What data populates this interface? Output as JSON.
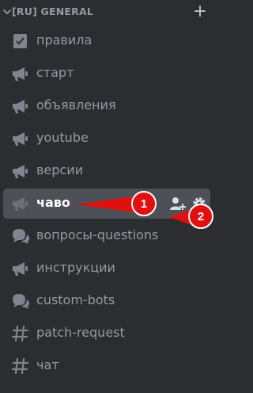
{
  "category": {
    "title": "[RU] GENERAL",
    "collapse_icon": "chevron-down-icon",
    "add_icon": "plus-icon"
  },
  "channels": [
    {
      "name": "правила",
      "icon": "rules-icon",
      "selected": false
    },
    {
      "name": "старт",
      "icon": "announcement-icon",
      "selected": false
    },
    {
      "name": "объявления",
      "icon": "announcement-icon",
      "selected": false
    },
    {
      "name": "youtube",
      "icon": "announcement-icon",
      "selected": false
    },
    {
      "name": "версии",
      "icon": "announcement-icon",
      "selected": false
    },
    {
      "name": "чаво",
      "icon": "announcement-icon",
      "selected": true
    },
    {
      "name": "вопросы-questions",
      "icon": "forum-icon",
      "selected": false
    },
    {
      "name": "инструкции",
      "icon": "announcement-icon",
      "selected": false
    },
    {
      "name": "custom-bots",
      "icon": "forum-icon",
      "selected": false
    },
    {
      "name": "patch-request",
      "icon": "hash-icon",
      "selected": false
    },
    {
      "name": "чат",
      "icon": "hash-icon",
      "selected": false
    }
  ],
  "selected_actions": [
    "invite-member-icon",
    "gear-icon"
  ],
  "annotations": [
    {
      "label": "1",
      "color": "#e01010"
    },
    {
      "label": "2",
      "color": "#e01010"
    }
  ],
  "colors": {
    "background": "#2b2d31",
    "selected_bg": "#4e5058",
    "muted_text": "#949ba4",
    "annotation_red": "#e01010"
  }
}
